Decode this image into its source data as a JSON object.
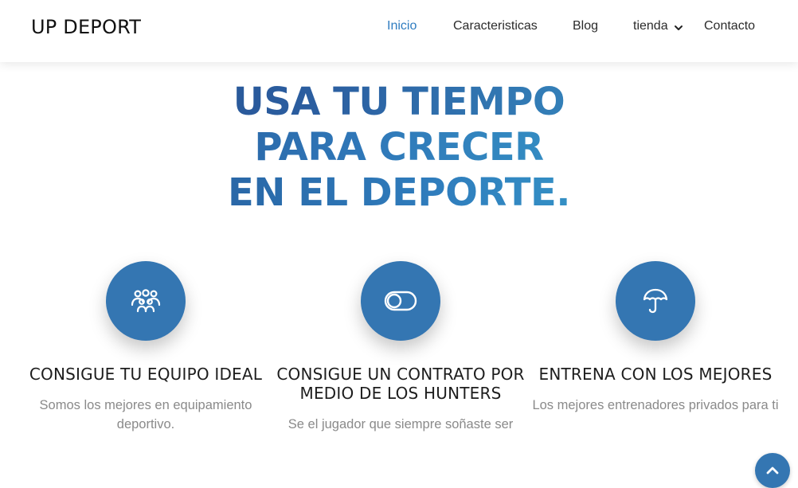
{
  "header": {
    "logo": "UP DEPORT",
    "nav": [
      {
        "label": "Inicio",
        "active": true
      },
      {
        "label": "Caracteristicas"
      },
      {
        "label": "Blog"
      },
      {
        "label": "tienda",
        "has_dropdown": true
      },
      {
        "label": "Contacto"
      }
    ]
  },
  "hero": {
    "lines": [
      "USA TU TIEMPO",
      "PARA CRECER",
      "EN EL DEPORTE."
    ]
  },
  "features": [
    {
      "icon": "team-icon",
      "title": "CONSIGUE TU EQUIPO IDEAL",
      "text": "Somos los mejores en equipamiento deportivo."
    },
    {
      "icon": "toggle-icon",
      "title": "CONSIGUE UN CONTRATO POR MEDIO DE LOS HUNTERS",
      "text": "Se el jugador que siempre soñaste ser"
    },
    {
      "icon": "umbrella-icon",
      "title": "ENTRENA CON LOS MEJORES",
      "text": "Los mejores entrenadores privados para ti"
    }
  ],
  "colors": {
    "accent": "#3476b2",
    "nav_active": "#2e7cc0",
    "hero_gradient_start": "#23508f",
    "hero_gradient_end": "#3cb0d2",
    "body_text": "#8a8a8a"
  },
  "scroll_top": {
    "icon": "chevron-up-icon"
  }
}
